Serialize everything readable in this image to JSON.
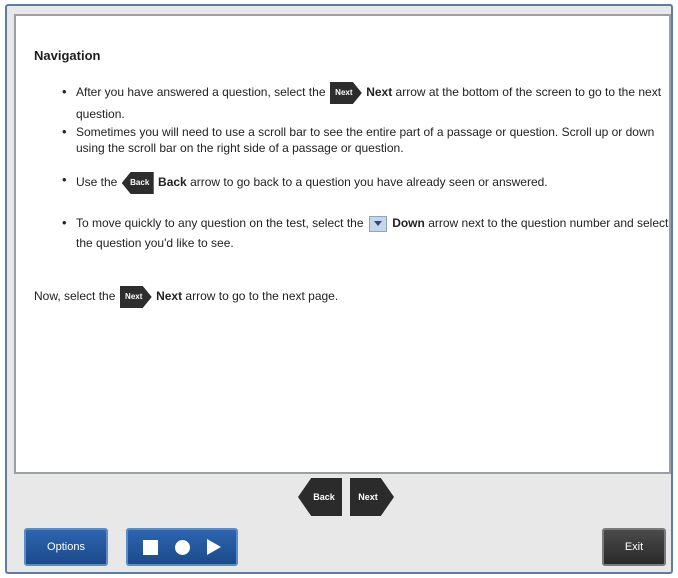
{
  "panel": {
    "title": "Navigation",
    "bullets": {
      "b1_pre": "After you have answered a question, select the",
      "b1_icon": "Next",
      "b1_bold": "Next",
      "b1_post": "arrow at the bottom of the screen to go to the next question.",
      "b2": "Sometimes you will need to use a scroll bar to see the entire part of a passage or question. Scroll up or down using the scroll bar on the right side of a passage or question.",
      "b3_pre": "Use the",
      "b3_icon": "Back",
      "b3_bold": "Back",
      "b3_post": "arrow to go back to a question you have already seen or answered.",
      "b4_pre": "To move quickly to any question on the test, select the",
      "b4_bold": "Down",
      "b4_post": "arrow next to the question number and select the question you'd like to see."
    },
    "now": {
      "pre": "Now, select the",
      "icon": "Next",
      "bold": "Next",
      "post": "arrow to go to the next page."
    }
  },
  "nav": {
    "back_label": "Back",
    "next_label": "Next"
  },
  "toolbar": {
    "options_label": "Options",
    "exit_label": "Exit",
    "media_icons": [
      "stop-icon",
      "record-icon",
      "play-icon"
    ]
  },
  "colors": {
    "frame_border": "#5d7da6",
    "toolbar_blue": "#1b4a8a",
    "arrow_dark": "#2d2d2d",
    "exit_gray": "#2a2a2a"
  }
}
